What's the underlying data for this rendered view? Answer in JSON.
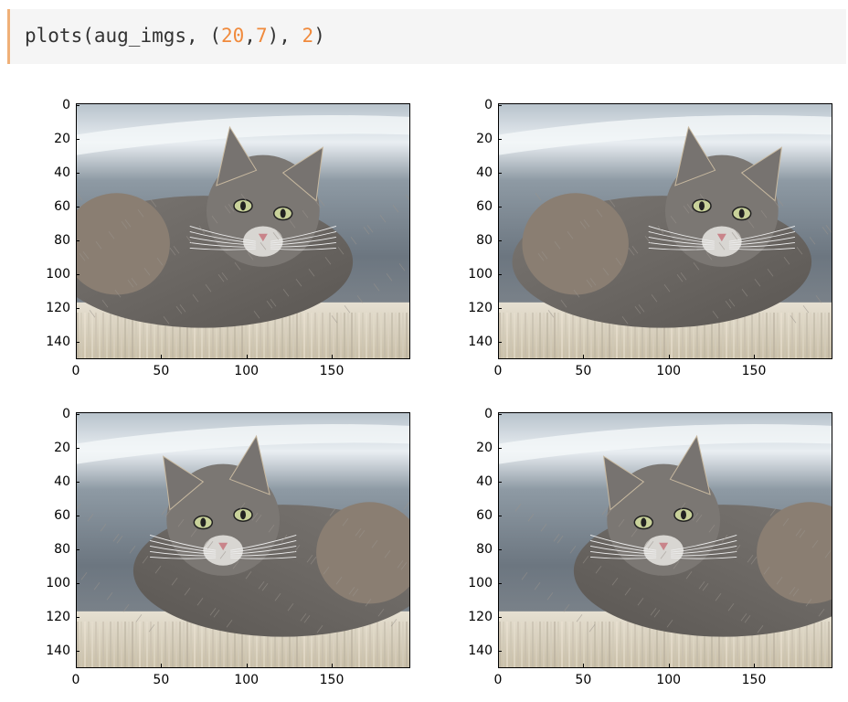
{
  "code": {
    "fn": "plots",
    "open": "(",
    "arg": "aug_imgs",
    "sep1": ", ",
    "tuple_open": "(",
    "n1": "20",
    "comma": ",",
    "n2": "7",
    "tuple_close": ")",
    "sep2": ", ",
    "n3": "2",
    "close": ")"
  },
  "subplots": [
    {
      "variant": "a",
      "y_ticks": [
        "0",
        "20",
        "40",
        "60",
        "80",
        "100",
        "120",
        "140"
      ],
      "x_ticks": [
        "0",
        "50",
        "100",
        "150"
      ]
    },
    {
      "variant": "b",
      "y_ticks": [
        "0",
        "20",
        "40",
        "60",
        "80",
        "100",
        "120",
        "140"
      ],
      "x_ticks": [
        "0",
        "50",
        "100",
        "150"
      ]
    },
    {
      "variant": "c",
      "y_ticks": [
        "0",
        "20",
        "40",
        "60",
        "80",
        "100",
        "120",
        "140"
      ],
      "x_ticks": [
        "0",
        "50",
        "100",
        "150"
      ]
    },
    {
      "variant": "d",
      "y_ticks": [
        "0",
        "20",
        "40",
        "60",
        "80",
        "100",
        "120",
        "140"
      ],
      "x_ticks": [
        "0",
        "50",
        "100",
        "150"
      ]
    }
  ],
  "colors": {
    "accent": "#f0b078",
    "number": "#f08a3c",
    "cell_bg": "#f5f5f5"
  }
}
